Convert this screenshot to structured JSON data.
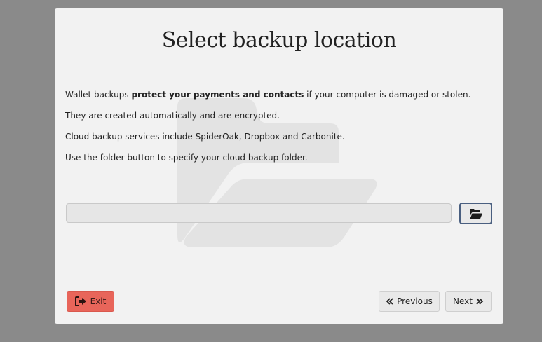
{
  "dialog": {
    "title": "Select backup location",
    "paragraphs": {
      "p1_before": "Wallet backups ",
      "p1_bold": "protect your payments and contacts",
      "p1_after": " if your computer is damaged or stolen.",
      "p2": "They are created automatically and are encrypted.",
      "p3": "Cloud backup services include SpiderOak, Dropbox and Carbonite.",
      "p4": "Use the folder button to specify your cloud backup folder."
    },
    "path_input": {
      "value": "",
      "placeholder": ""
    },
    "icons": {
      "folder": "folder-open-icon",
      "exit": "sign-out-icon",
      "previous": "double-chevron-left-icon",
      "next": "double-chevron-right-icon",
      "watermark": "folder-open-icon"
    }
  },
  "footer": {
    "exit_label": "Exit",
    "previous_label": "Previous",
    "next_label": "Next"
  },
  "colors": {
    "backdrop": "#8a8a8a",
    "dialog_bg": "#f2f2f2",
    "exit_button": "#e8655a",
    "focus_border": "#4a5f80",
    "watermark": "#e3e3e3"
  }
}
